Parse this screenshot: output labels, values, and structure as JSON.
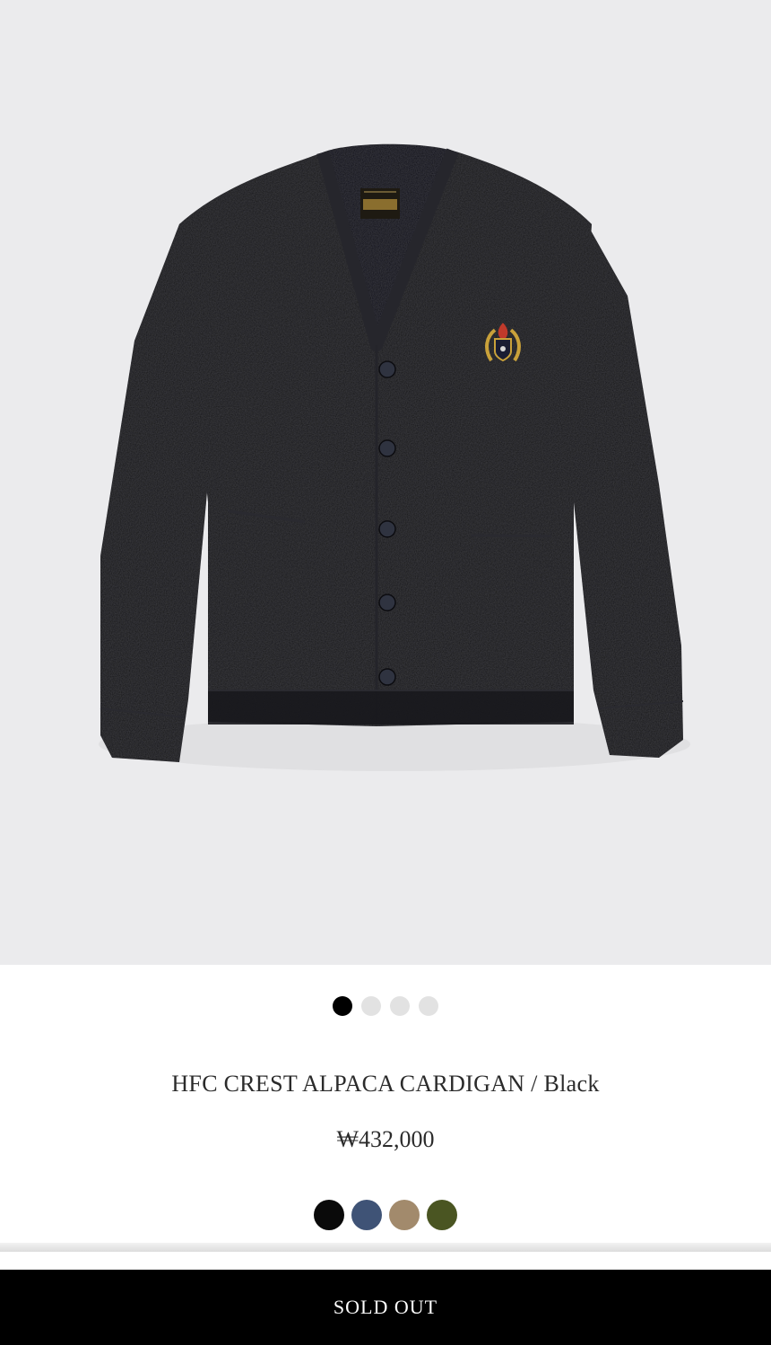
{
  "product": {
    "title": "HFC CREST ALPACA CARDIGAN / Black",
    "price": "₩432,000",
    "image_label": "black alpaca cardigan product photo"
  },
  "gallery": {
    "total": 4,
    "active_index": 0
  },
  "colors": [
    {
      "name": "Black",
      "hex": "#0a0a0a"
    },
    {
      "name": "Navy",
      "hex": "#3f5376"
    },
    {
      "name": "Beige",
      "hex": "#a28a6c"
    },
    {
      "name": "Olive",
      "hex": "#4a5522"
    }
  ],
  "cta": {
    "label": "SOLD OUT"
  },
  "theme": {
    "image_bg": "#ebebed",
    "dot_active": "#000000",
    "dot_inactive": "#e2e2e2",
    "button_bg": "#000000",
    "button_text": "#ffffff"
  }
}
